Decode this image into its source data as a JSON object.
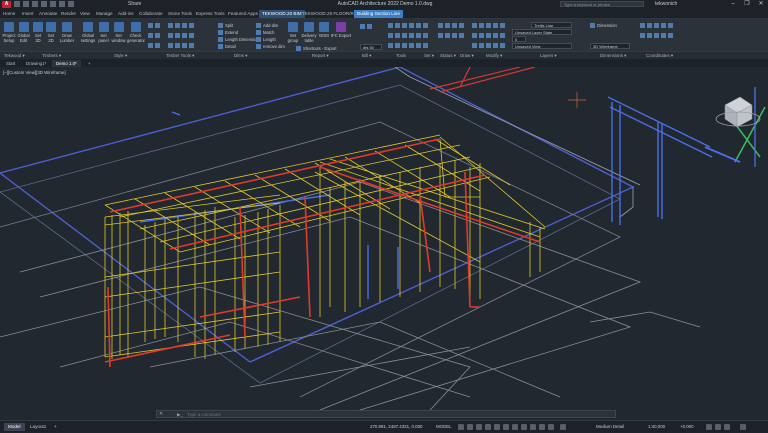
{
  "titlebar": {
    "app_logo": "A",
    "share": "Share",
    "title": "AutoCAD Architecture 2022   Demo 1.0.dwg",
    "search_placeholder": "Type a keyword or phrase",
    "user": "tekwonich",
    "min": "–",
    "max": "❐",
    "close": "✕"
  },
  "ribbon_tabs": [
    "Home",
    "Insert",
    "Annotate",
    "Render",
    "View",
    "Manage",
    "Add-ins",
    "Collaborate",
    "Stone Tools",
    "Express Tools",
    "Featured Apps",
    "TEKWOOD.20 BIM",
    "TEKWOOD.20 FLOOR/ROOF",
    "Building Section Line"
  ],
  "ribbon": {
    "project_setup": "Project Setup",
    "global_edit": "Global Edit",
    "set_3d": "Set 3D",
    "set_2d": "Set 2D",
    "draw_lumber": "Draw Lumber",
    "global_settings": "Global settings",
    "set_panel": "Set panel",
    "set_window": "Set window",
    "check_generator": "Check generator",
    "split": "Split",
    "extend": "Extend",
    "length_dimension": "Length Dimension",
    "detail": "Detail",
    "add_dim": "Add dim",
    "match": "Match",
    "length": "Length",
    "remove_dim": "remove dim",
    "set_group": "Set group",
    "delivery_table": "Delivery table",
    "bom": "BOM",
    "ifc_export": "IFC Export",
    "shortcuts_export": "Shortcuts - Export",
    "dist_value": "dfs 50",
    "layer_dropdown": "Unsaved Layer State",
    "layer_current": "0",
    "layer_view": "Unsaved View",
    "dimension": "Dimension",
    "visual_style": "3D Wireframe",
    "layer_color": "Trellis Line"
  },
  "ribbon_panels": [
    "Tekwood ▾",
    "Timbers ▾",
    "Style ▾",
    "Timber Tools ▾",
    "Dims ▾",
    "Report ▾",
    "Bill ▾",
    "Tools",
    "Set ▾",
    "Status ▾",
    "Draw ▾",
    "Modify ▾",
    "Layers ▾",
    "Dimensions ▾",
    "Coordinates ▾"
  ],
  "doc_tabs": {
    "start": "Start",
    "drawing": "Drawing1*",
    "demo": "Demo 1.0*",
    "add": "+"
  },
  "viewport": {
    "label": "[–][Custom View][3D Wireframe]"
  },
  "command": {
    "close": "✕",
    "prompt": "▶_",
    "placeholder": "Type a command"
  },
  "status": {
    "model": "Model",
    "layout1": "Layout1",
    "add_layout": "+",
    "coords": "270.891, 2487.4331, 0.000",
    "mode": "MODEL",
    "detail": "Medium Detail",
    "scale": "1:40,000",
    "elev": "+0.000"
  }
}
